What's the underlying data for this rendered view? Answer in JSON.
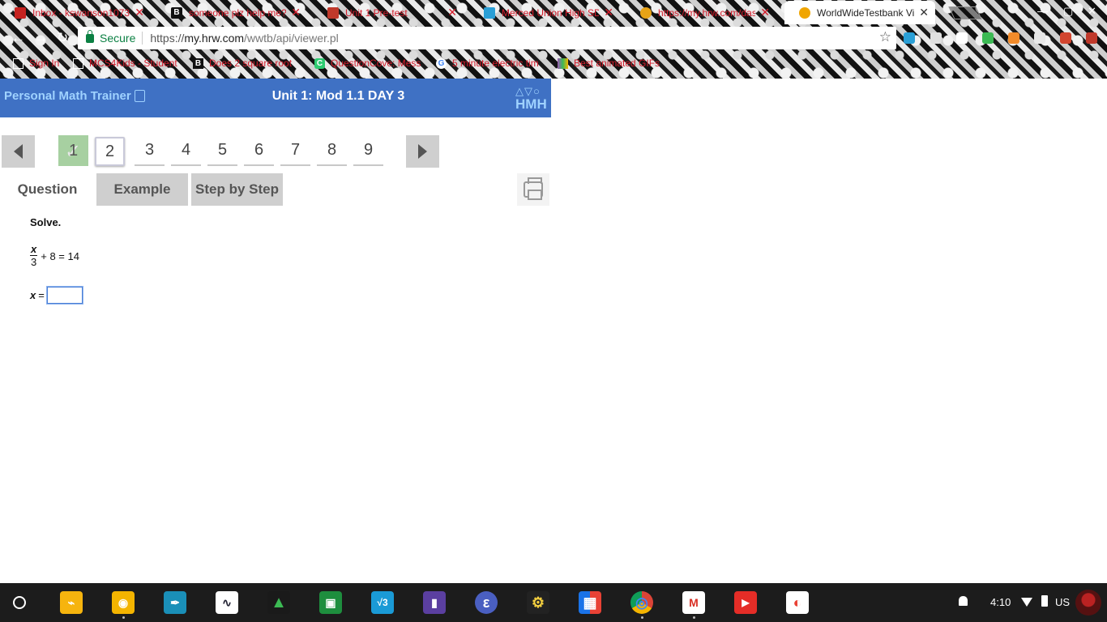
{
  "browser": {
    "tabs": [
      {
        "title": "Inbox - kswanson1073@",
        "icon_color": "#c5221f",
        "icon": "gmail-icon",
        "glyph": "",
        "active": false
      },
      {
        "title": "someone plz help me??",
        "icon_color": "#111111",
        "icon": "brainly-icon",
        "glyph": "B",
        "active": false
      },
      {
        "title": "Unit 1 Pre-test",
        "icon_color": "#c0392b",
        "icon": "classroom-icon",
        "glyph": "",
        "active": false
      },
      {
        "title": "Merced Union High SD",
        "icon_color": "#2a9fd6",
        "icon": "cloud-icon",
        "glyph": "",
        "active": false
      },
      {
        "title": "https://my.hrw.com/das",
        "icon_color": "#e8a317",
        "icon": "globe-icon",
        "glyph": "",
        "active": false
      },
      {
        "title": "WorldWideTestbank View",
        "icon_color": "#f0a500",
        "icon": "globe-icon",
        "glyph": "",
        "active": true
      }
    ],
    "window_controls": {
      "minimize": "—",
      "maximize": "▢",
      "close": "✕"
    },
    "omnibox": {
      "secure_label": "Secure",
      "url_scheme": "https://",
      "url_host": "my.hrw.com",
      "url_path": "/wwtb/api/viewer.pl"
    },
    "bookmarks": [
      {
        "label": "Sign In",
        "icon": "page-icon",
        "color": "#ffffff",
        "glyph": ""
      },
      {
        "label": "MCS4Kids - Student",
        "icon": "page-icon",
        "color": "#ffffff",
        "glyph": ""
      },
      {
        "label": "Does 2 square root",
        "icon": "brainly-icon",
        "color": "#111111",
        "glyph": "B"
      },
      {
        "label": "QuestionCove: Mess",
        "icon": "questioncove-icon",
        "color": "#2ecc71",
        "glyph": "C"
      },
      {
        "label": "5 minute electric tim",
        "icon": "google-icon",
        "color": "#ffffff",
        "glyph": "G"
      },
      {
        "label": "Best animated GIFs",
        "icon": "gif-icon",
        "color": "#9b59b6",
        "glyph": ""
      }
    ]
  },
  "app": {
    "brand": "Personal Math Trainer",
    "title": "Unit 1: Mod 1.1 DAY 3",
    "publisher_shapes": "△▽○",
    "publisher": "HMH"
  },
  "question_nav": {
    "numbers": [
      "1",
      "2",
      "3",
      "4",
      "5",
      "6",
      "7",
      "8",
      "9"
    ],
    "completed": [
      "1"
    ],
    "current": "2",
    "check_mark": "✓"
  },
  "content_tabs": {
    "question": "Question",
    "example": "Example",
    "step_by_step": "Step by Step"
  },
  "problem": {
    "prompt": "Solve.",
    "numerator": "x",
    "denominator": "3",
    "rest": "+ 8 = 14",
    "answer_variable": "x",
    "answer_equals": "=",
    "answer_value": ""
  },
  "taskbar": {
    "apps": [
      {
        "name": "keep-icon",
        "color": "#f6b40e",
        "glyph": "⌁"
      },
      {
        "name": "lightbulb-icon",
        "color": "#f4b400",
        "glyph": "◉"
      },
      {
        "name": "pen-icon",
        "color": "#1a8fb8",
        "glyph": "✒"
      },
      {
        "name": "desmos-icon",
        "color": "#ffffff",
        "glyph": "∿"
      },
      {
        "name": "drive-icon",
        "color": "#1a1a1a",
        "glyph": "▲"
      },
      {
        "name": "classroom-icon",
        "color": "#1e8e3e",
        "glyph": "▣"
      },
      {
        "name": "vcube-icon",
        "color": "#1a9ad6",
        "glyph": "√3"
      },
      {
        "name": "notebook-icon",
        "color": "#5b3fa0",
        "glyph": "▮"
      },
      {
        "name": "epub-icon",
        "color": "#4a5fc1",
        "glyph": "ε"
      },
      {
        "name": "gear-app-icon",
        "color": "#222222",
        "glyph": "⚙"
      },
      {
        "name": "puzzle-icon",
        "color": "#1a73e8",
        "glyph": "▦"
      },
      {
        "name": "chrome-icon",
        "color": "#1a1a1a",
        "glyph": "◎"
      },
      {
        "name": "gmail-icon",
        "color": "#ffffff",
        "glyph": "M"
      },
      {
        "name": "youtube-icon",
        "color": "#e52d27",
        "glyph": "▶"
      },
      {
        "name": "photos-icon",
        "color": "#ffffff",
        "glyph": "◐"
      }
    ],
    "clock": "4:10",
    "keyboard": "US"
  }
}
